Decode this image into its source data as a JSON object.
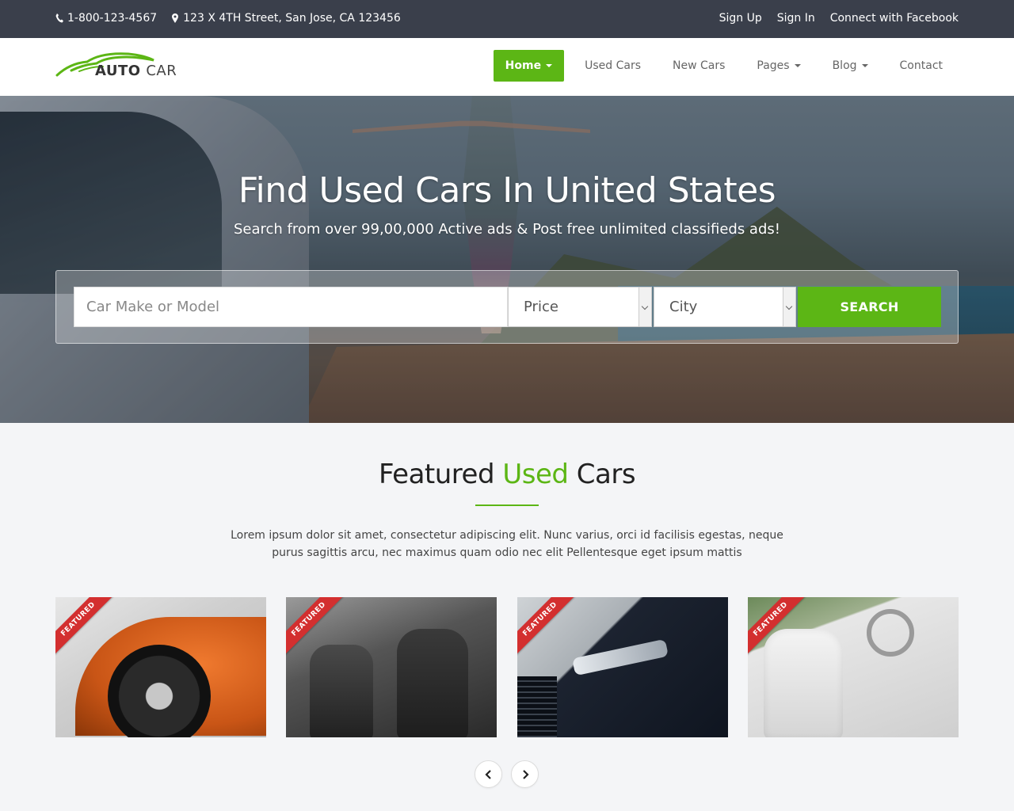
{
  "topbar": {
    "phone": "1-800-123-4567",
    "address": "123 X 4TH Street, San Jose, CA 123456",
    "links": [
      "Sign Up",
      "Sign In",
      "Connect with Facebook"
    ]
  },
  "brand": {
    "name_main": "AUTO",
    "name_second": "CAR",
    "accent": "#5cb615"
  },
  "nav": {
    "items": [
      {
        "label": "Home"
      },
      {
        "label": "Used Cars"
      },
      {
        "label": "New Cars"
      },
      {
        "label": "Pages"
      },
      {
        "label": "Blog"
      },
      {
        "label": "Contact"
      }
    ]
  },
  "hero": {
    "title": "Find Used Cars In United States",
    "subtitle": "Search from over 99,00,000 Active ads & Post free unlimited classifieds ads!"
  },
  "search": {
    "placeholder": "Car Make or Model",
    "price_label": "Price",
    "city_label": "City",
    "button_label": "SEARCH"
  },
  "featured": {
    "title_start": "Featured ",
    "title_accent": "Used",
    "title_end": " Cars",
    "description": "Lorem ipsum dolor sit amet, consectetur adipiscing elit. Nunc varius, orci id facilisis egestas, neque purus sagittis arcu, nec maximus quam odio nec elit Pellentesque eget ipsum mattis",
    "ribbon": "FEATURED"
  }
}
